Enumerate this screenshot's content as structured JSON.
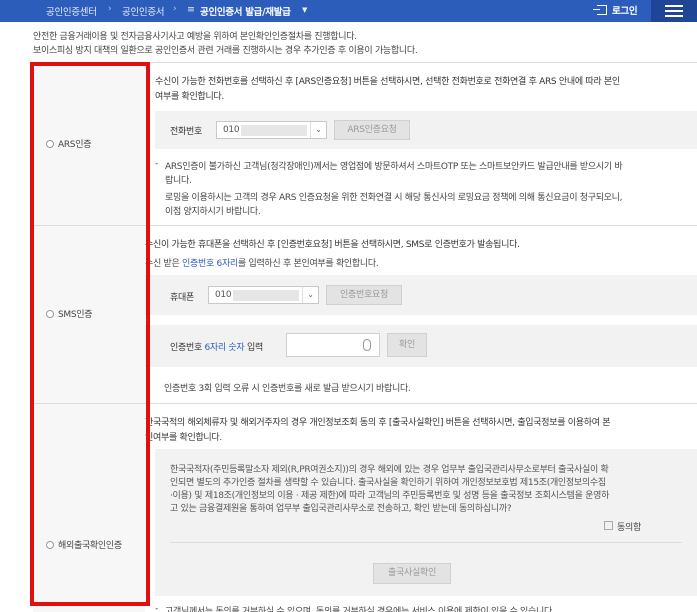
{
  "nav": {
    "crumb1": "공인인증센터",
    "crumb2": "공인인증서",
    "crumb3": "공인인증서 발급/재발급",
    "logout": "로그인"
  },
  "intro": {
    "line1": "안전한 금융거래이용 및 전자금융사기사고 예방을 위하여 본인확인인증절차를 진행합니다.",
    "line2": "보이스피싱 방지 대책의 일환으로 공인인증서 관련 거래를 진행하시는 경우 추가인증 후 이용이 가능합니다."
  },
  "ars": {
    "radio_label": "ARS인증",
    "desc1": "수신이 가능한 전화번호를 선택하신 후 [ARS인증요청] 버튼을 선택하시면, 선택한 전화번호로 전화연결 후 ARS 안내에 따라 본인",
    "desc2": "여부를 확인합니다.",
    "phone_label": "전화번호",
    "phone_value": "010",
    "button": "ARS인증요청",
    "note1a": "ARS인증이 불가하신 고객님(청각장애인)께서는 영업점에 방문하셔서 스마트OTP 또는 스마트보안카드 발급안내를 받으시기 바",
    "note1b": "랍니다.",
    "note2a": "로밍을 이용하시는 고객의 경우 ARS 인증요청을 위한 전화연결 시 해당 통신사의 로밍요금 정책에 의해 통신요금이 청구되오니,",
    "note2b": "이점 양지하시기 바랍니다."
  },
  "sms": {
    "radio_label": "SMS인증",
    "desc1": "수신이 가능한 휴대폰을 선택하신 후 [인증번호요청] 버튼을 선택하시면, SMS로 인증번호가 발송됩니다.",
    "desc2_pre": "수신 받은 ",
    "desc2_blue": "인증번호 6자리",
    "desc2_post": "를 입력하신 후 본인여부를 확인합니다.",
    "phone_label": "휴대폰",
    "phone_value": "010",
    "request_button": "인증번호요청",
    "code_label_pre": "인증번호 ",
    "code_label_blue": "6자리 숫자",
    "code_label_post": " 입력",
    "confirm_button": "확인",
    "note": "인증번호 3회 입력 오류 시 인증번호를 새로 발급 받으시기 바랍니다."
  },
  "overseas": {
    "radio_label": "해외출국확인인증",
    "desc1": "한국국적의 해외체류자 및 해외거주자의 경우 개인정보조회 동의 후 [출국사실확인] 버튼을 선택하시면, 출입국정보를 이용하여 본",
    "desc2": "인여부를 확인합니다.",
    "consent1": "한국국적자(주민등록말소자 제외(R,PR여권소지))의 경우 해외에 있는 경우 업무부 출입국관리사무소로부터 출국사실이 확",
    "consent2": "인되면 별도의 추가인증 절차를 생략할 수 있습니다. 출국사실을 확인하기 위하여 개인정보보호법 제15조(개인정보의수집",
    "consent3": "·이용) 및 제18조(개인정보의 이용 · 제공 제한)에 따라 고객님의 주민등록번호 및 성명 등을 출국정보 조회시스템을 운영하",
    "consent4": "고 있는 금융결제원을 통하여 업무부 출입국관리사무소로 전송하고, 확인 받는데 동의하십니까?",
    "agree_label": "동의함",
    "button": "출국사실확인",
    "footnote": "고객님께서는 동의를 거부하실 수 있으며, 동의를 거부하실 경우에는 서비스 이용에 제한이 있을 수 있습니다."
  }
}
